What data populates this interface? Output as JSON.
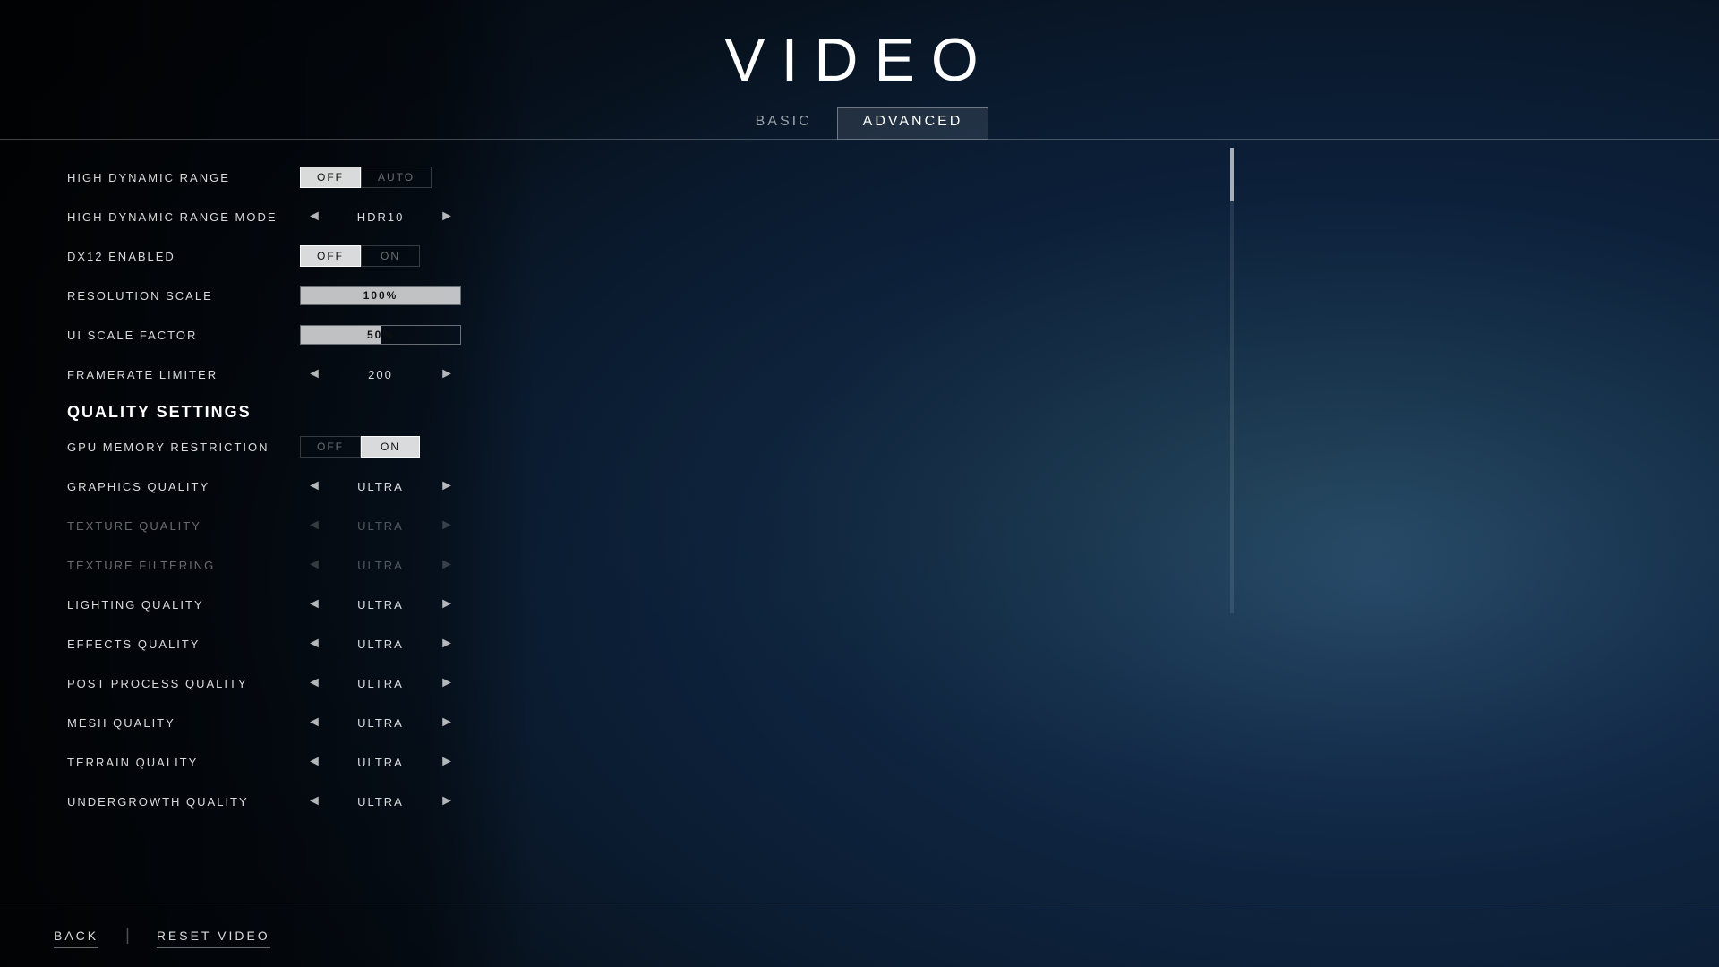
{
  "page": {
    "title": "VIDEO"
  },
  "tabs": [
    {
      "id": "basic",
      "label": "BASIC",
      "active": false
    },
    {
      "id": "advanced",
      "label": "ADVANCED",
      "active": true
    }
  ],
  "settings": {
    "hdr": {
      "label": "HIGH DYNAMIC RANGE",
      "off_label": "OFF",
      "auto_label": "AUTO",
      "state": "off"
    },
    "hdr_mode": {
      "label": "HIGH DYNAMIC RANGE MODE",
      "value": "HDR10"
    },
    "dx12": {
      "label": "DX12 ENABLED",
      "off_label": "OFF",
      "on_label": "ON",
      "state": "off"
    },
    "resolution_scale": {
      "label": "RESOLUTION SCALE",
      "value": "100%",
      "fill_percent": 100
    },
    "ui_scale_factor": {
      "label": "UI SCALE FACTOR",
      "value": "50%",
      "fill_percent": 50
    },
    "framerate_limiter": {
      "label": "FRAMERATE LIMITER",
      "value": "200"
    },
    "quality_settings_heading": "QUALITY SETTINGS",
    "gpu_memory_restriction": {
      "label": "GPU MEMORY RESTRICTION",
      "off_label": "OFF",
      "on_label": "ON",
      "state": "on"
    },
    "graphics_quality": {
      "label": "GRAPHICS QUALITY",
      "value": "ULTRA",
      "dimmed": false
    },
    "texture_quality": {
      "label": "TEXTURE QUALITY",
      "value": "ULTRA",
      "dimmed": true
    },
    "texture_filtering": {
      "label": "TEXTURE FILTERING",
      "value": "ULTRA",
      "dimmed": true
    },
    "lighting_quality": {
      "label": "LIGHTING QUALITY",
      "value": "ULTRA",
      "dimmed": false
    },
    "effects_quality": {
      "label": "EFFECTS QUALITY",
      "value": "ULTRA",
      "dimmed": false
    },
    "post_process_quality": {
      "label": "POST PROCESS QUALITY",
      "value": "ULTRA",
      "dimmed": false
    },
    "mesh_quality": {
      "label": "MESH QUALITY",
      "value": "ULTRA",
      "dimmed": false
    },
    "terrain_quality": {
      "label": "TERRAIN QUALITY",
      "value": "ULTRA",
      "dimmed": false
    },
    "undergrowth_quality": {
      "label": "UNDERGROWTH QUALITY",
      "value": "ULTRA",
      "dimmed": false
    }
  },
  "bottom_buttons": {
    "back": "BACK",
    "reset": "RESET VIDEO"
  },
  "icons": {
    "arrow_left": "◄",
    "arrow_right": "►"
  }
}
